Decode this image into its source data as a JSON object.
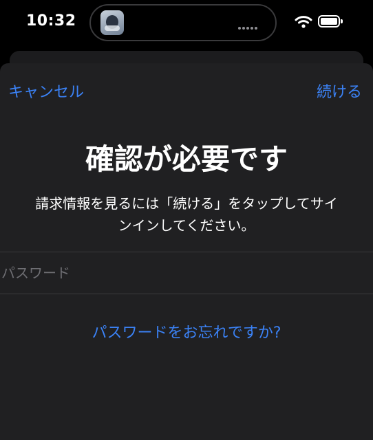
{
  "status_bar": {
    "time": "10:32"
  },
  "nav": {
    "cancel_label": "キャンセル",
    "continue_label": "続ける"
  },
  "dialog": {
    "title": "確認が必要です",
    "message_line1": "請求情報を見るには「続ける」をタップしてサイ",
    "message_line2": "ンインしてください。"
  },
  "password_field": {
    "placeholder": "パスワード",
    "value": ""
  },
  "forgot_password_label": "パスワードをお忘れですか?",
  "colors": {
    "accent": "#3b82f6",
    "sheet_background": "#202022",
    "background": "#000000"
  }
}
